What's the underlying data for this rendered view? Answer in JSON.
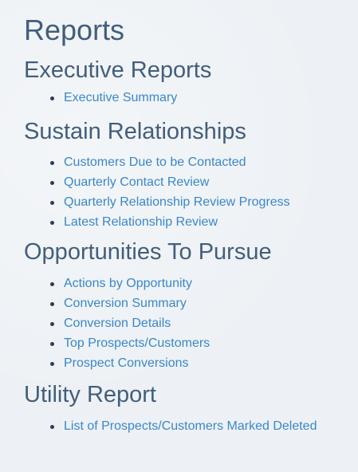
{
  "page": {
    "title": "Reports"
  },
  "sections": [
    {
      "title": "Executive Reports",
      "links": [
        "Executive Summary"
      ]
    },
    {
      "title": "Sustain Relationships",
      "links": [
        "Customers Due to be Contacted",
        "Quarterly Contact Review",
        "Quarterly Relationship Review Progress",
        "Latest Relationship Review"
      ]
    },
    {
      "title": "Opportunities To Pursue",
      "links": [
        "Actions by Opportunity",
        "Conversion Summary",
        "Conversion Details",
        "Top Prospects/Customers",
        "Prospect Conversions"
      ]
    },
    {
      "title": "Utility Report",
      "links": [
        "List of Prospects/Customers Marked Deleted"
      ]
    }
  ],
  "colors": {
    "background": "#edf1f5",
    "heading": "#435e7c",
    "link": "#3a87c8",
    "bullet": "#2a3f55"
  }
}
